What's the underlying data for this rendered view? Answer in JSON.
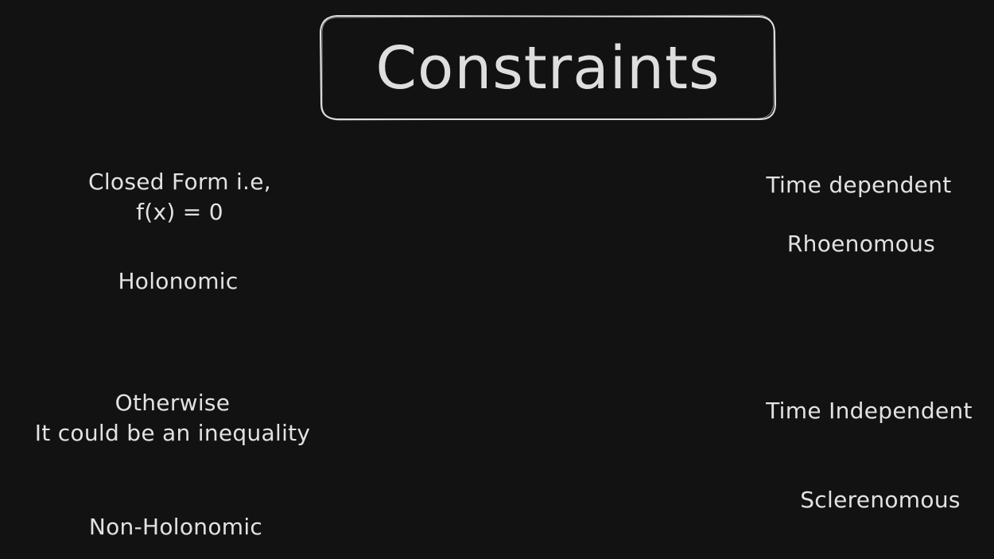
{
  "title": "Constraints",
  "colors": {
    "background": "#121212",
    "stroke": "#dedede",
    "text": "#e2e2e2"
  },
  "left": {
    "holonomic_condition": {
      "line1": "Closed Form i.e,",
      "line2": "f(x) = 0"
    },
    "holonomic_label": "Holonomic",
    "nonholonomic_condition": {
      "line1": "Otherwise",
      "line2": "It could be an inequality"
    },
    "nonholonomic_label": "Non-Holonomic"
  },
  "right": {
    "time_dependent_label": "Time dependent",
    "rheonomous_label": "Rhoenomous",
    "time_independent_label": "Time Independent",
    "scleronomous_label": "Sclerenomous"
  }
}
